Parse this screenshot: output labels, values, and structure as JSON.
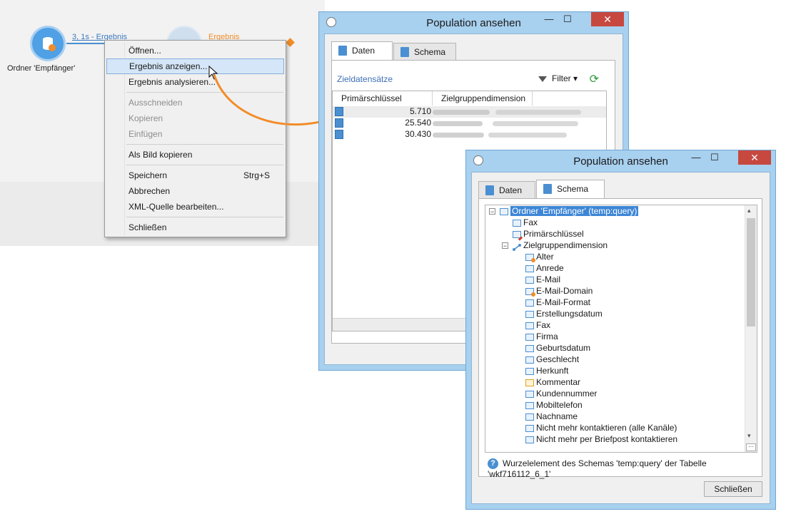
{
  "workflow": {
    "node_label": "Ordner 'Empfänger'",
    "edge_label": "3, 1s - Ergebnis",
    "result_label": "Ergebnis"
  },
  "context_menu": {
    "items": [
      {
        "label": "Öffnen...",
        "enabled": true
      },
      {
        "label": "Ergebnis anzeigen...",
        "enabled": true,
        "highlighted": true
      },
      {
        "label": "Ergebnis analysieren...",
        "enabled": true
      },
      {
        "label": "Ausschneiden",
        "enabled": false
      },
      {
        "label": "Kopieren",
        "enabled": false
      },
      {
        "label": "Einfügen",
        "enabled": false
      },
      {
        "label": "Als Bild kopieren",
        "enabled": true
      },
      {
        "label": "Speichern",
        "enabled": true,
        "shortcut": "Strg+S"
      },
      {
        "label": "Abbrechen",
        "enabled": true
      },
      {
        "label": "XML-Quelle bearbeiten...",
        "enabled": true
      },
      {
        "label": "Schließen",
        "enabled": true
      }
    ]
  },
  "dialog_data": {
    "title": "Population ansehen",
    "tabs": [
      "Daten",
      "Schema"
    ],
    "active_tab": "Daten",
    "section_title": "Zieldatensätze",
    "filter_label": "Filter",
    "columns": [
      "Primärschlüssel",
      "Zielgruppendimension"
    ],
    "rows": [
      {
        "key": "5.710"
      },
      {
        "key": "25.540"
      },
      {
        "key": "30.430"
      }
    ]
  },
  "dialog_schema": {
    "title": "Population ansehen",
    "tabs": [
      "Daten",
      "Schema"
    ],
    "active_tab": "Schema",
    "tree": {
      "root": "Ordner 'Empfänger' (temp:query)",
      "children": [
        "Fax",
        "Primärschlüssel"
      ],
      "dimension": "Zielgruppendimension",
      "fields": [
        "Alter",
        "Anrede",
        "E-Mail",
        "E-Mail-Domain",
        "E-Mail-Format",
        "Erstellungsdatum",
        "Fax",
        "Firma",
        "Geburtsdatum",
        "Geschlecht",
        "Herkunft",
        "Kommentar",
        "Kundennummer",
        "Mobiltelefon",
        "Nachname",
        "Nicht mehr kontaktieren (alle Kanäle)",
        "Nicht mehr per Briefpost kontaktieren"
      ]
    },
    "status_text": "Wurzelelement des Schemas 'temp:query' der Tabelle 'wkf716112_6_1'",
    "close_button": "Schließen"
  },
  "colors": {
    "accent": "#4a8fd1",
    "orange": "#f28c28",
    "window_frame": "#a8d0ef",
    "close_red": "#c7483f"
  }
}
